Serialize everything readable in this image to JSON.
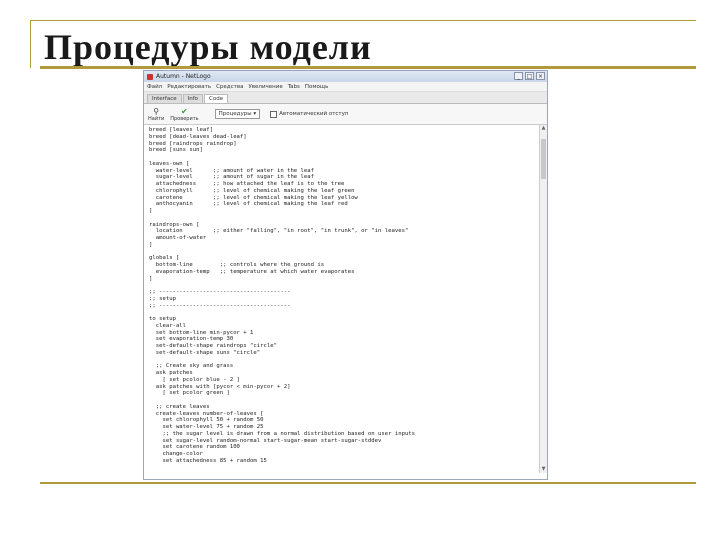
{
  "slide": {
    "title": "Процедуры модели"
  },
  "window": {
    "title": "Autumn - NetLogo",
    "controls": [
      "_",
      "□",
      "×"
    ]
  },
  "menu": [
    "Файл",
    "Редактировать",
    "Средства",
    "Увеличение",
    "Tabs",
    "Помощь"
  ],
  "tabs": [
    "Interface",
    "Info",
    "Code"
  ],
  "toolbar": {
    "find_label": "Найти",
    "check_label": "Проверить",
    "procedures_label": "Процедуры",
    "indent_label": "Автоматический отступ"
  },
  "code_lines": [
    "breed [leaves leaf]",
    "breed [dead-leaves dead-leaf]",
    "breed [raindrops raindrop]",
    "breed [suns sun]",
    "",
    "leaves-own [",
    "  water-level      ;; amount of water in the leaf",
    "  sugar-level      ;; amount of sugar in the leaf",
    "  attachedness     ;; how attached the leaf is to the tree",
    "  chlorophyll      ;; level of chemical making the leaf green",
    "  carotene         ;; level of chemical making the leaf yellow",
    "  anthocyanin      ;; level of chemical making the leaf red",
    "]",
    "",
    "raindrops-own [",
    "  location         ;; either \"falling\", \"in root\", \"in trunk\", or \"in leaves\"",
    "  amount-of-water",
    "]",
    "",
    "globals [",
    "  bottom-line        ;; controls where the ground is",
    "  evaporation-temp   ;; temperature at which water evaporates",
    "]",
    "",
    ";; ---------------------------------------",
    ";; setup",
    ";; ---------------------------------------",
    "",
    "to setup",
    "  clear-all",
    "  set bottom-line min-pycor + 1",
    "  set evaporation-temp 30",
    "  set-default-shape raindrops \"circle\"",
    "  set-default-shape suns \"circle\"",
    "",
    "  ;; Create sky and grass",
    "  ask patches",
    "    [ set pcolor blue - 2 ]",
    "  ask patches with [pycor < min-pycor + 2]",
    "    [ set pcolor green ]",
    "",
    "  ;; create leaves",
    "  create-leaves number-of-leaves [",
    "    set chlorophyll 50 + random 50",
    "    set water-level 75 + random 25",
    "    ;; the sugar level is drawn from a normal distribution based on user inputs",
    "    set sugar-level random-normal start-sugar-mean start-sugar-stddev",
    "    set carotene random 100",
    "    change-color",
    "    set attachedness 85 + random 15"
  ]
}
